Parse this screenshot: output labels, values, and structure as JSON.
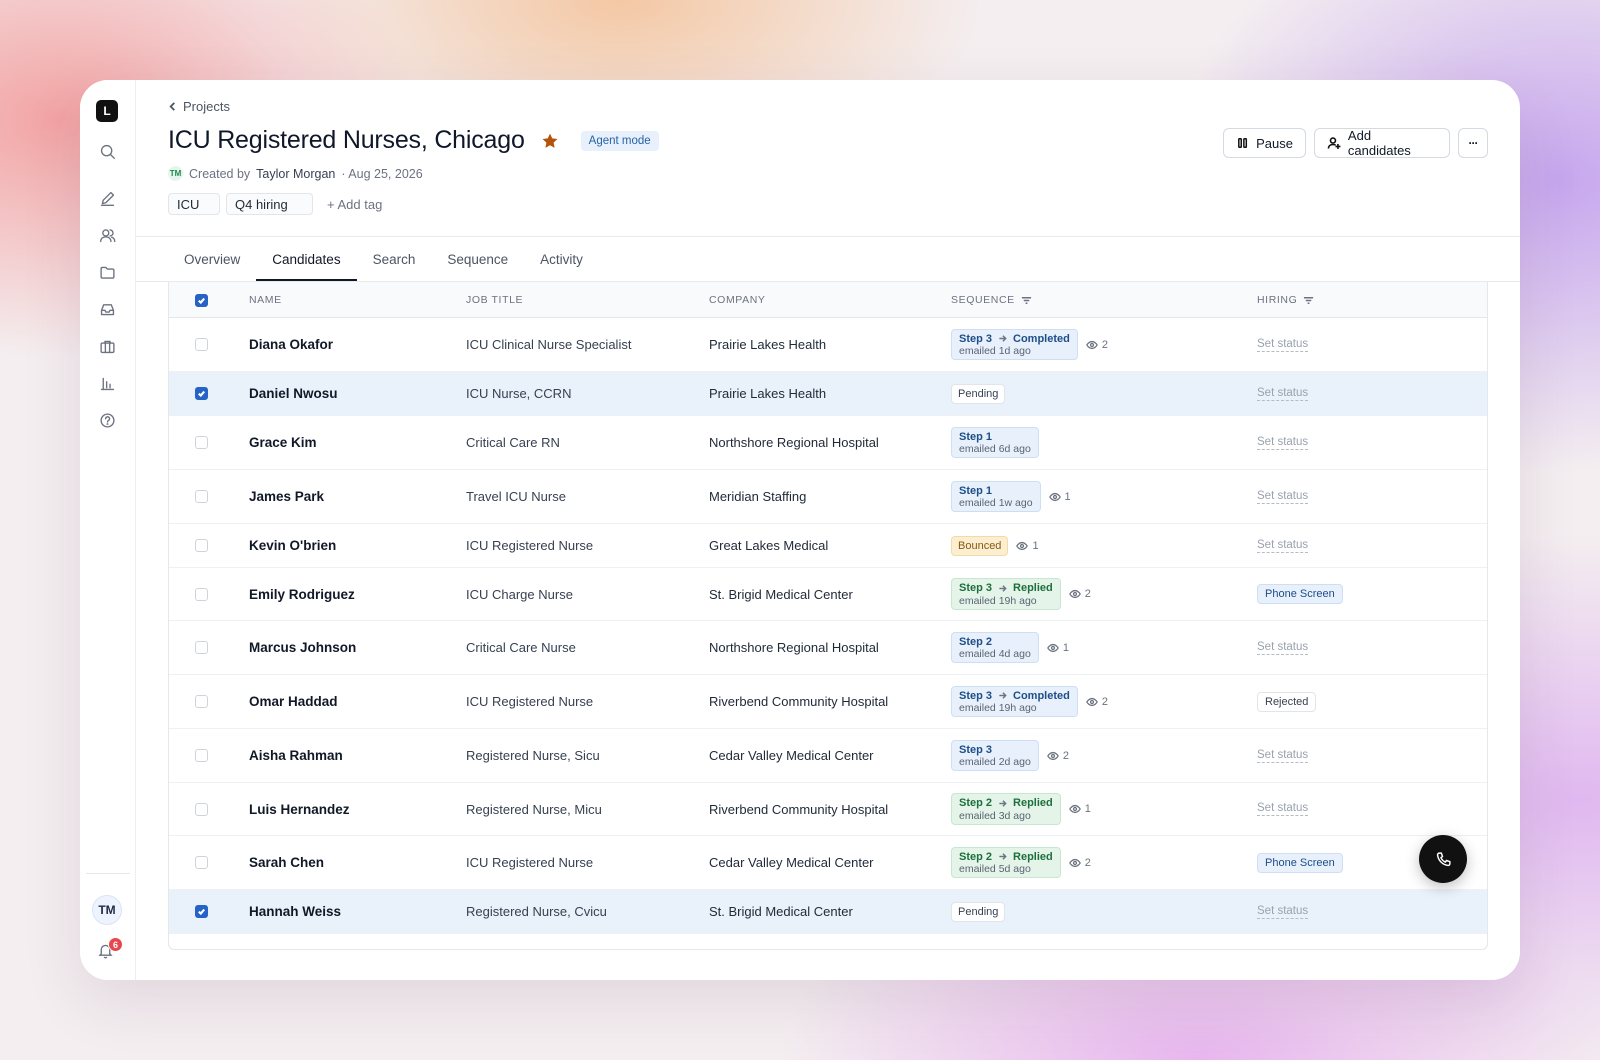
{
  "app": {
    "logo_letter": "L"
  },
  "sidebar": {
    "icons": [
      "search-icon",
      "edit-icon",
      "users-icon",
      "folder-icon",
      "inbox-icon",
      "briefcase-icon",
      "bar-chart-icon",
      "help-icon"
    ],
    "user_initials": "TM",
    "notifications_count": "6"
  },
  "header": {
    "breadcrumb": "Projects",
    "title": "ICU Registered Nurses, Chicago",
    "mode_badge": "Agent mode",
    "creator_initials": "TM",
    "created_by_label": "Created by",
    "creator": "Taylor Morgan",
    "created_date": "· Aug 25, 2026",
    "tags": [
      "ICU",
      "Q4 hiring"
    ],
    "add_tag_label": "+ Add tag",
    "actions": {
      "pause": "Pause",
      "add_candidates": "Add candidates",
      "more": "···"
    }
  },
  "tabs": [
    "Overview",
    "Candidates",
    "Search",
    "Sequence",
    "Activity"
  ],
  "active_tab": "Candidates",
  "table": {
    "columns": {
      "name": "NAME",
      "job_title": "JOB TITLE",
      "company": "COMPANY",
      "sequence": "SEQUENCE",
      "hiring": "HIRING"
    },
    "rows": [
      {
        "name": "Diana Okafor",
        "title": "ICU Clinical Nurse Specialist",
        "company": "Prairie Lakes Health",
        "selected": false,
        "seq": {
          "kind": "step",
          "color": "blue",
          "step": "Step 3",
          "outcome": "Completed",
          "sub": "emailed 1d ago",
          "views": "2"
        },
        "hiring": {
          "kind": "set",
          "label": "Set status"
        }
      },
      {
        "name": "Daniel Nwosu",
        "title": "ICU Nurse, CCRN",
        "company": "Prairie Lakes Health",
        "selected": true,
        "seq": {
          "kind": "pill",
          "style": "pending",
          "label": "Pending"
        },
        "hiring": {
          "kind": "set",
          "label": "Set status"
        }
      },
      {
        "name": "Grace Kim",
        "title": "Critical Care RN",
        "company": "Northshore Regional Hospital",
        "selected": false,
        "seq": {
          "kind": "step",
          "color": "blue",
          "step": "Step 1",
          "outcome": "",
          "sub": "emailed 6d ago",
          "views": ""
        },
        "hiring": {
          "kind": "set",
          "label": "Set status"
        }
      },
      {
        "name": "James Park",
        "title": "Travel ICU Nurse",
        "company": "Meridian Staffing",
        "selected": false,
        "seq": {
          "kind": "step",
          "color": "blue",
          "step": "Step 1",
          "outcome": "",
          "sub": "emailed 1w ago",
          "views": "1"
        },
        "hiring": {
          "kind": "set",
          "label": "Set status"
        }
      },
      {
        "name": "Kevin O'brien",
        "title": "ICU Registered Nurse",
        "company": "Great Lakes Medical",
        "selected": false,
        "seq": {
          "kind": "pill",
          "style": "bounced",
          "label": "Bounced",
          "views": "1"
        },
        "hiring": {
          "kind": "set",
          "label": "Set status"
        }
      },
      {
        "name": "Emily Rodriguez",
        "title": "ICU Charge Nurse",
        "company": "St. Brigid Medical Center",
        "selected": false,
        "seq": {
          "kind": "step",
          "color": "green",
          "step": "Step 3",
          "outcome": "Replied",
          "sub": "emailed 19h ago",
          "views": "2"
        },
        "hiring": {
          "kind": "pill",
          "style": "phone",
          "label": "Phone Screen"
        }
      },
      {
        "name": "Marcus Johnson",
        "title": "Critical Care Nurse",
        "company": "Northshore Regional Hospital",
        "selected": false,
        "seq": {
          "kind": "step",
          "color": "blue",
          "step": "Step 2",
          "outcome": "",
          "sub": "emailed 4d ago",
          "views": "1"
        },
        "hiring": {
          "kind": "set",
          "label": "Set status"
        }
      },
      {
        "name": "Omar Haddad",
        "title": "ICU Registered Nurse",
        "company": "Riverbend Community Hospital",
        "selected": false,
        "seq": {
          "kind": "step",
          "color": "blue",
          "step": "Step 3",
          "outcome": "Completed",
          "sub": "emailed 19h ago",
          "views": "2"
        },
        "hiring": {
          "kind": "pill",
          "style": "rejected",
          "label": "Rejected"
        }
      },
      {
        "name": "Aisha Rahman",
        "title": "Registered Nurse, Sicu",
        "company": "Cedar Valley Medical Center",
        "selected": false,
        "seq": {
          "kind": "step",
          "color": "blue",
          "step": "Step 3",
          "outcome": "",
          "sub": "emailed 2d ago",
          "views": "2"
        },
        "hiring": {
          "kind": "set",
          "label": "Set status"
        }
      },
      {
        "name": "Luis Hernandez",
        "title": "Registered Nurse, Micu",
        "company": "Riverbend Community Hospital",
        "selected": false,
        "seq": {
          "kind": "step",
          "color": "green",
          "step": "Step 2",
          "outcome": "Replied",
          "sub": "emailed 3d ago",
          "views": "1"
        },
        "hiring": {
          "kind": "set",
          "label": "Set status"
        }
      },
      {
        "name": "Sarah Chen",
        "title": "ICU Registered Nurse",
        "company": "Cedar Valley Medical Center",
        "selected": false,
        "seq": {
          "kind": "step",
          "color": "green",
          "step": "Step 2",
          "outcome": "Replied",
          "sub": "emailed 5d ago",
          "views": "2"
        },
        "hiring": {
          "kind": "pill",
          "style": "phone",
          "label": "Phone Screen"
        }
      },
      {
        "name": "Hannah Weiss",
        "title": "Registered Nurse, Cvicu",
        "company": "St. Brigid Medical Center",
        "selected": true,
        "seq": {
          "kind": "pill",
          "style": "pending",
          "label": "Pending"
        },
        "hiring": {
          "kind": "set",
          "label": "Set status"
        }
      }
    ]
  },
  "colors": {
    "accent": "#2563c6",
    "selected_row": "#e9f1fb",
    "star": "#b45309",
    "badge_red": "#e5484d"
  }
}
